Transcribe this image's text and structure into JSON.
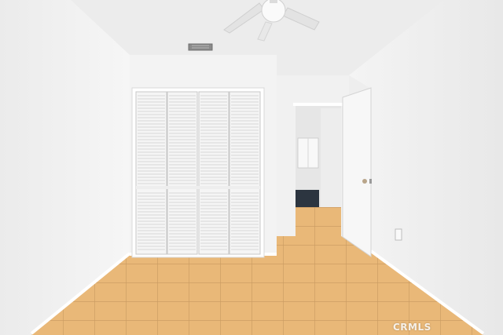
{
  "image": {
    "watermark": "CRMLS",
    "colors": {
      "wall": "#f2f2f2",
      "ceiling": "#ececec",
      "tile": "#e9b878",
      "grout": "#c89960",
      "trim": "#ffffff"
    }
  }
}
